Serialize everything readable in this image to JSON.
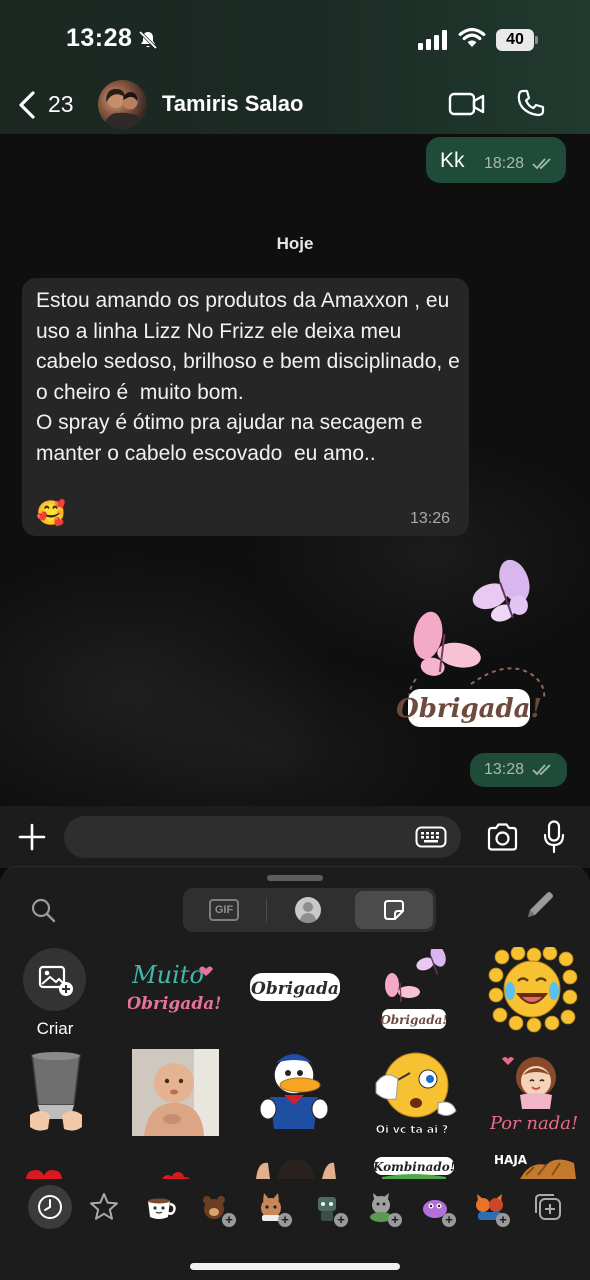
{
  "status_bar": {
    "time": "13:28",
    "battery": "40"
  },
  "header": {
    "back_count": "23",
    "contact_name": "Tamiris Salao"
  },
  "chat": {
    "outgoing_text": {
      "text": "Kk",
      "time": "18:28"
    },
    "day_separator": "Hoje",
    "incoming": {
      "text": "Estou amando os produtos da Amaxxon , eu uso a linha Lizz No Frizz ele deixa meu cabelo sedoso, brilhoso e bem disciplinado, e o cheiro é  muito bom.\nO spray é ótimo pra ajudar na secagem e  manter o cabelo escovado  eu amo..",
      "emoji": "🥰",
      "time": "13:26"
    },
    "sent_sticker": {
      "caption": "Obrigada!",
      "time": "13:28"
    }
  },
  "composer": {
    "placeholder": ""
  },
  "sticker_panel": {
    "tabs": {
      "gif": "GIF"
    },
    "create_label": "Criar",
    "stickers_row1": [
      "Muito",
      "Obrigada!",
      "Obrigada",
      "Obrigada!"
    ],
    "stickers_row2": [
      "Oi vc ta ai ?",
      "Por nada!"
    ],
    "stickers_row3": [
      "Kombinado!",
      "HAJA"
    ]
  },
  "colors": {
    "outgoing_bubble": "#1f4c39",
    "incoming_bubble": "#262626",
    "panel_bg": "#1c1c1c"
  }
}
